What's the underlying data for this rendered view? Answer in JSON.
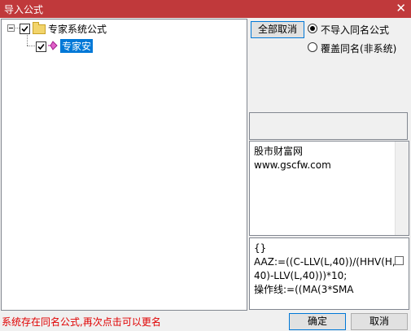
{
  "window": {
    "title": "导入公式",
    "close_glyph": "✕"
  },
  "tree": {
    "root": {
      "label": "专家系统公式",
      "checked": true,
      "icon": "folder-icon"
    },
    "child": {
      "label": "专家安",
      "checked": true,
      "icon": "formula-icon"
    }
  },
  "controls": {
    "clear_all_label": "全部取消",
    "radio_no_import": "不导入同名公式",
    "radio_overwrite": "覆盖同名(非系统)",
    "selected_radio": "no_import"
  },
  "info": {
    "line1": "股市财富网",
    "line2": "www.gscfw.com"
  },
  "formula": {
    "text": "{}\nAAZ:=((C-LLV(L,40))/(HHV(H,40)-LLV(L,40)))*10;\n操作线:=((MA(3*SMA"
  },
  "footer": {
    "status": "系统存在同名公式,再次点击可以更名",
    "ok_label": "确定",
    "cancel_label": "取消"
  }
}
